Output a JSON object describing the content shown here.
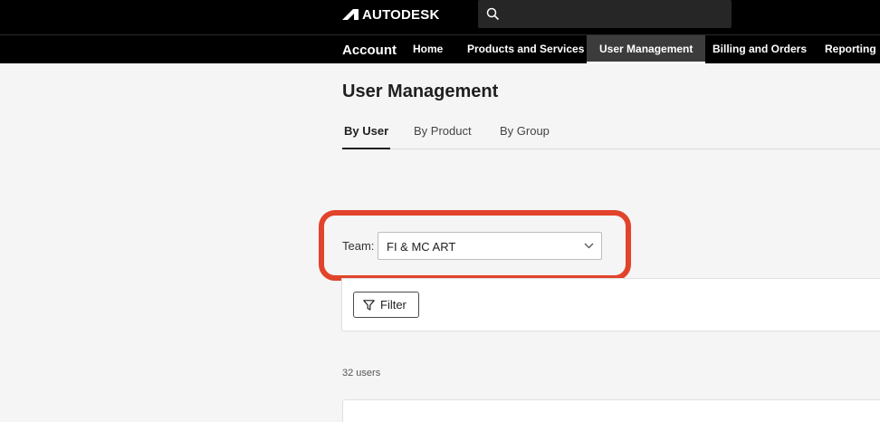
{
  "brand": {
    "logo_text": "AUTODESK",
    "logo_icon": "autodesk-a-icon"
  },
  "search": {
    "icon": "search-icon",
    "placeholder": ""
  },
  "nav": {
    "account_label": "Account",
    "items": [
      {
        "label": "Home"
      },
      {
        "label": "Products and Services"
      },
      {
        "label": "User Management",
        "active": true
      },
      {
        "label": "Billing and Orders"
      },
      {
        "label": "Reporting"
      }
    ]
  },
  "page": {
    "title": "User Management"
  },
  "tabs": [
    {
      "label": "By User",
      "active": true
    },
    {
      "label": "By Product"
    },
    {
      "label": "By Group"
    }
  ],
  "team": {
    "label": "Team:",
    "selected": "FI & MC ART",
    "chevron_icon": "chevron-down-icon"
  },
  "filter": {
    "label": "Filter",
    "icon": "filter-icon"
  },
  "users": {
    "count_text": "32 users"
  },
  "colors": {
    "topbar": "#000000",
    "highlight": "#e2432b",
    "background": "#f5f5f5"
  }
}
